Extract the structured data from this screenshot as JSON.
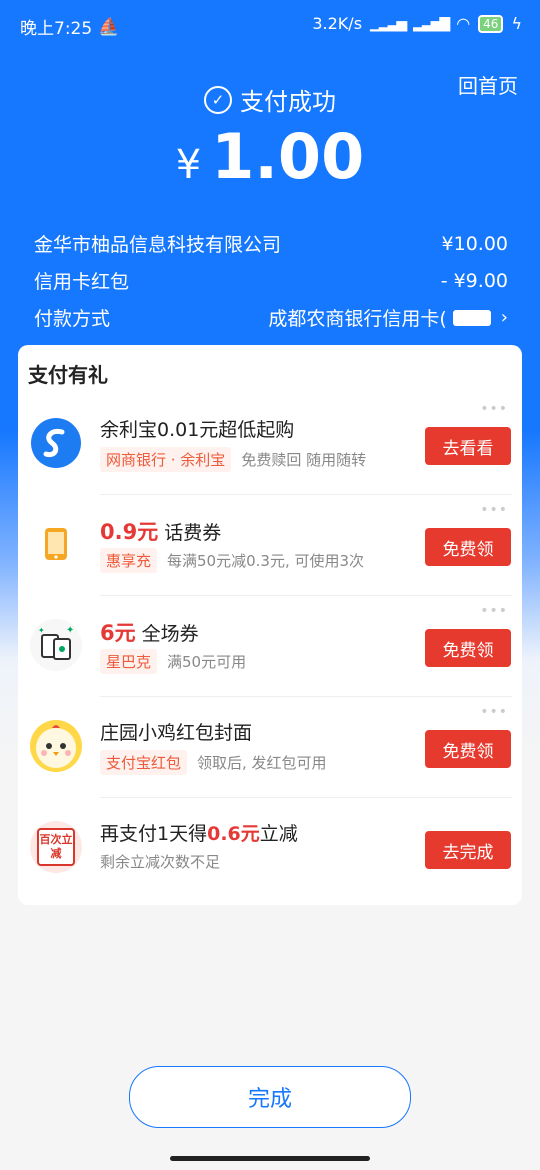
{
  "status_bar": {
    "time": "晚上7:25",
    "speed": "3.2K/s",
    "battery": "46"
  },
  "header": {
    "home_link": "回首页",
    "status_text": "支付成功",
    "currency": "¥",
    "amount": "1.00"
  },
  "details": [
    {
      "label": "金华市柚品信息科技有限公司",
      "value": "¥10.00"
    },
    {
      "label": "信用卡红包",
      "value": "- ¥9.00"
    },
    {
      "label": "付款方式",
      "value": "成都农商银行信用卡("
    }
  ],
  "gift": {
    "title": "支付有礼",
    "items": [
      {
        "title": "余利宝0.01元超低起购",
        "title_highlight": "",
        "tag": "网商银行 · 余利宝",
        "desc": "免费赎回  随用随转",
        "button": "去看看",
        "icon": "yulibao-icon"
      },
      {
        "title_highlight": "0.9元",
        "title": " 话费券",
        "tag": "惠享充",
        "desc": "每满50元减0.3元, 可使用3次",
        "button": "免费领",
        "icon": "phone-icon"
      },
      {
        "title_highlight": "6元",
        "title": " 全场券",
        "tag": "星巴克",
        "desc": "满50元可用",
        "button": "免费领",
        "icon": "coffee-icon"
      },
      {
        "title": "庄园小鸡红包封面",
        "title_highlight": "",
        "tag": "支付宝红包",
        "desc": "领取后, 发红包可用",
        "button": "免费领",
        "icon": "chicken-icon"
      },
      {
        "title_pre": "再支付1天得",
        "title_highlight": "0.6元",
        "title": "立减",
        "tag": "",
        "desc": "剩余立减次数不足",
        "button": "去完成",
        "icon": "discount-icon",
        "icon_text": "百次立减"
      }
    ]
  },
  "done_button": "完成",
  "colors": {
    "primary": "#1677ff",
    "accent_red": "#e73a2f"
  }
}
